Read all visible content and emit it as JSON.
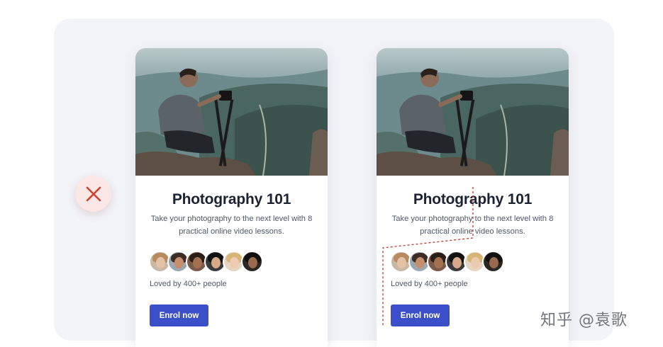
{
  "cards": [
    {
      "title": "Photography 101",
      "description": "Take your photography to the next level with 8 practical online video lessons.",
      "social_proof": "Loved by 400+ people",
      "button_label": "Enrol now"
    },
    {
      "title": "Photography 101",
      "description": "Take your photography to the next level with 8 practical online video lessons.",
      "social_proof": "Loved by 400+ people",
      "button_label": "Enrol now"
    }
  ],
  "badge": {
    "icon": "close-icon",
    "color": "#d04434",
    "background": "#fbe7e5"
  },
  "button_color": "#3b4fc9",
  "guide_line_color": "#c0392b",
  "watermark": "知乎 @袁歌"
}
